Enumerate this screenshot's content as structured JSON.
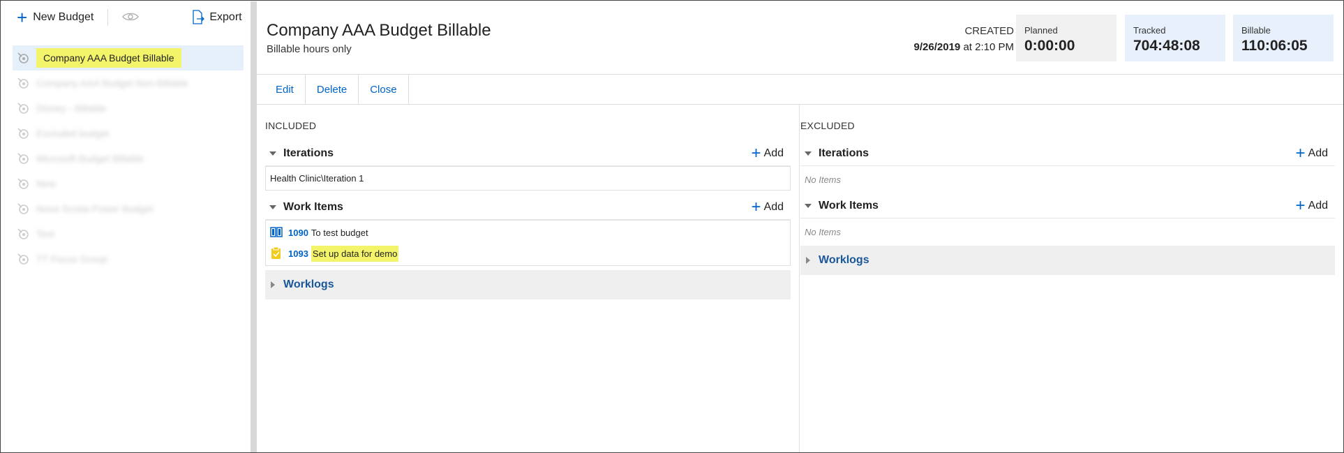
{
  "toolbar": {
    "new_budget_label": "New Budget",
    "export_label": "Export"
  },
  "budgets": [
    {
      "name": "Company AAA Budget Billable",
      "selected": true
    },
    {
      "name": "Company AAA Budget Non-Billable"
    },
    {
      "name": "Disney - Billable"
    },
    {
      "name": "Excluded budget"
    },
    {
      "name": "Microsoft Budget Billable"
    },
    {
      "name": "New"
    },
    {
      "name": "Nova Scotia Power Budget"
    },
    {
      "name": "Test"
    },
    {
      "name": "TT Focus Group"
    }
  ],
  "header": {
    "title": "Company AAA Budget Billable",
    "subtitle": "Billable hours only",
    "created_label": "CREATED",
    "created_date": "9/26/2019",
    "created_at": "at",
    "created_time": "2:10 PM"
  },
  "stats": {
    "planned": {
      "label": "Planned",
      "value": "0:00:00"
    },
    "tracked": {
      "label": "Tracked",
      "value": "704:48:08"
    },
    "billable": {
      "label": "Billable",
      "value": "110:06:05"
    }
  },
  "actions": {
    "edit": "Edit",
    "delete": "Delete",
    "close": "Close"
  },
  "included": {
    "title": "INCLUDED",
    "iterations_title": "Iterations",
    "add_label": "Add",
    "iterations": [
      "Health Clinic\\Iteration 1"
    ],
    "work_items_title": "Work Items",
    "work_items": [
      {
        "id": "1090",
        "title": "To test budget"
      },
      {
        "id": "1093",
        "title": "Set up data for demo"
      }
    ],
    "worklogs_title": "Worklogs"
  },
  "excluded": {
    "title": "EXCLUDED",
    "iterations_title": "Iterations",
    "add_label": "Add",
    "no_items": "No Items",
    "work_items_title": "Work Items",
    "worklogs_title": "Worklogs"
  },
  "colors": {
    "accent": "#0064c8",
    "highlight": "#f4f46a",
    "worklog_link": "#1a5799"
  }
}
